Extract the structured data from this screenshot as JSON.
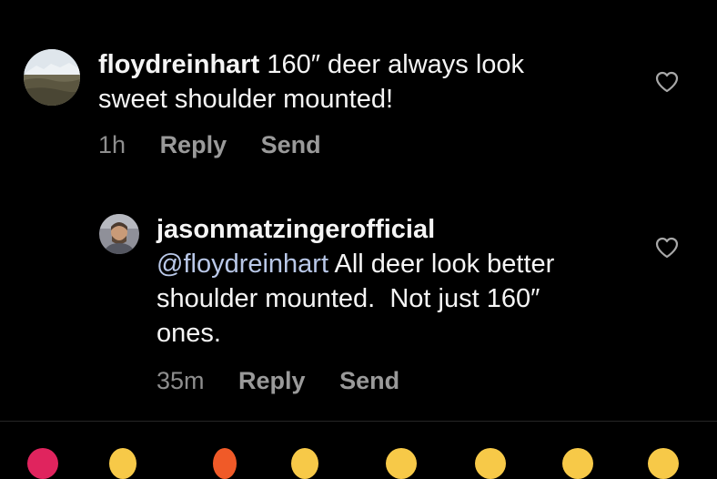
{
  "comments": [
    {
      "username": "floydreinhart",
      "text": "160″ deer always look sweet shoulder mounted!",
      "line1": "160″ deer always look",
      "line2": "sweet shoulder mounted!",
      "time": "1h",
      "reply_label": "Reply",
      "send_label": "Send",
      "like_icon": "heart-outline-icon"
    },
    {
      "username": "jasonmatzingerofficial",
      "mention": "@floydreinhart",
      "line1": "All deer look better",
      "line2": "shoulder mounted.  Not just 160″",
      "line3": "ones.",
      "time": "35m",
      "reply_label": "Reply",
      "send_label": "Send",
      "like_icon": "heart-outline-icon"
    }
  ],
  "colors": {
    "background": "#000000",
    "text": "#f5f5f5",
    "meta": "#8e8e8e",
    "mention": "#b9c8e8",
    "reaction_red": "#e0245e",
    "reaction_yellow": "#f7c948"
  }
}
